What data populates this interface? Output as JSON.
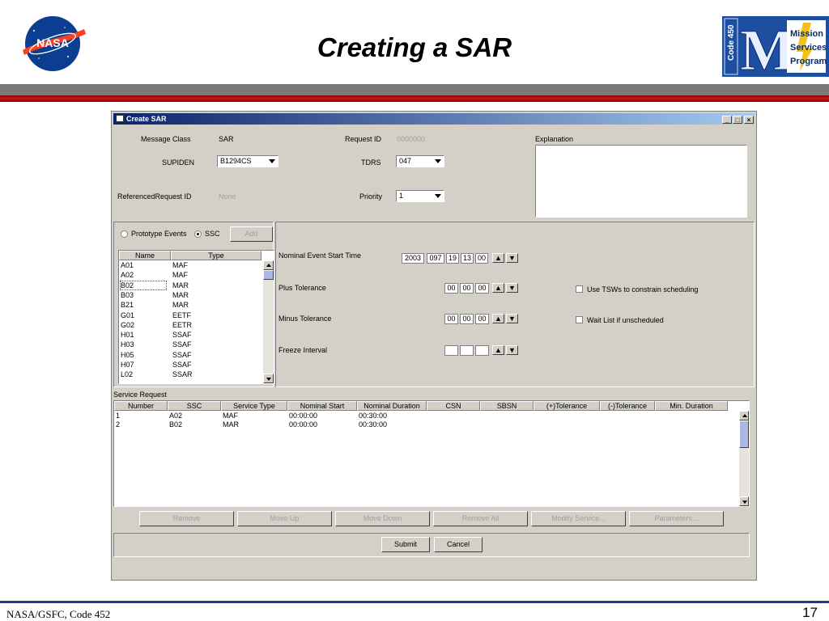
{
  "slide": {
    "title": "Creating a SAR",
    "nasa_logo_text": "NASA",
    "msp_logo": {
      "letter": "M",
      "code": "Code 450",
      "lines": [
        "Mission",
        "Services",
        "Program"
      ]
    },
    "footer_left": "NASA/GSFC, Code 452",
    "page_number": "17"
  },
  "window": {
    "title": "Create SAR",
    "controls": {
      "minimize": "_",
      "maximize": "□",
      "close": "×"
    }
  },
  "form": {
    "message_class_label": "Message Class",
    "message_class_value": "SAR",
    "request_id_label": "Request ID",
    "request_id_value": "0000000",
    "explanation_label": "Explanation",
    "supiden_label": "SUPIDEN",
    "supiden_value": "B1294CS",
    "tdrs_label": "TDRS",
    "tdrs_value": "047",
    "referenced_label": "ReferencedRequest ID",
    "referenced_value": "None",
    "priority_label": "Priority",
    "priority_value": "1"
  },
  "events": {
    "prototype_label": "Prototype Events",
    "ssc_label": "SSC",
    "selected": "SSC",
    "add_label": "Add",
    "columns": [
      "Name",
      "Type"
    ],
    "rows": [
      [
        "A01",
        "MAF"
      ],
      [
        "A02",
        "MAF"
      ],
      [
        "B02",
        "MAR"
      ],
      [
        "B03",
        "MAR"
      ],
      [
        "B21",
        "MAR"
      ],
      [
        "G01",
        "EETF"
      ],
      [
        "G02",
        "EETR"
      ],
      [
        "H01",
        "SSAF"
      ],
      [
        "H03",
        "SSAF"
      ],
      [
        "H05",
        "SSAF"
      ],
      [
        "H07",
        "SSAF"
      ],
      [
        "L02",
        "SSAR"
      ]
    ],
    "selected_row": "B02"
  },
  "timing": {
    "nominal_label": "Nominal Event Start Time",
    "nominal_values": [
      "2003",
      "097",
      "19",
      "13",
      "00"
    ],
    "plus_label": "Plus Tolerance",
    "plus_values": [
      "00",
      "00",
      "00"
    ],
    "minus_label": "Minus Tolerance",
    "minus_values": [
      "00",
      "00",
      "00"
    ],
    "freeze_label": "Freeze Interval",
    "freeze_values": [
      "",
      "",
      ""
    ],
    "use_tsw_label": "Use TSWs to constrain scheduling",
    "use_tsw_checked": false,
    "wait_list_label": "Wait List if unscheduled",
    "wait_list_checked": false
  },
  "service_request": {
    "label": "Service Request",
    "columns": [
      "Number",
      "SSC",
      "Service Type",
      "Nominal Start",
      "Nominal Duration",
      "CSN",
      "SBSN",
      "(+)Tolerance",
      "(-)Tolerance",
      "Min. Duration"
    ],
    "rows": [
      [
        "1",
        "A02",
        "MAF",
        "00:00:00",
        "00:30:00"
      ],
      [
        "2",
        "B02",
        "MAR",
        "00:00:00",
        "00:30:00"
      ]
    ]
  },
  "actions": {
    "remove": "Remove",
    "move_up": "Move Up",
    "move_down": "Move Down",
    "remove_all": "Remove All",
    "modify_service": "Modify Service...",
    "parameters": "Parameters..."
  },
  "bottom": {
    "submit": "Submit",
    "cancel": "Cancel"
  }
}
